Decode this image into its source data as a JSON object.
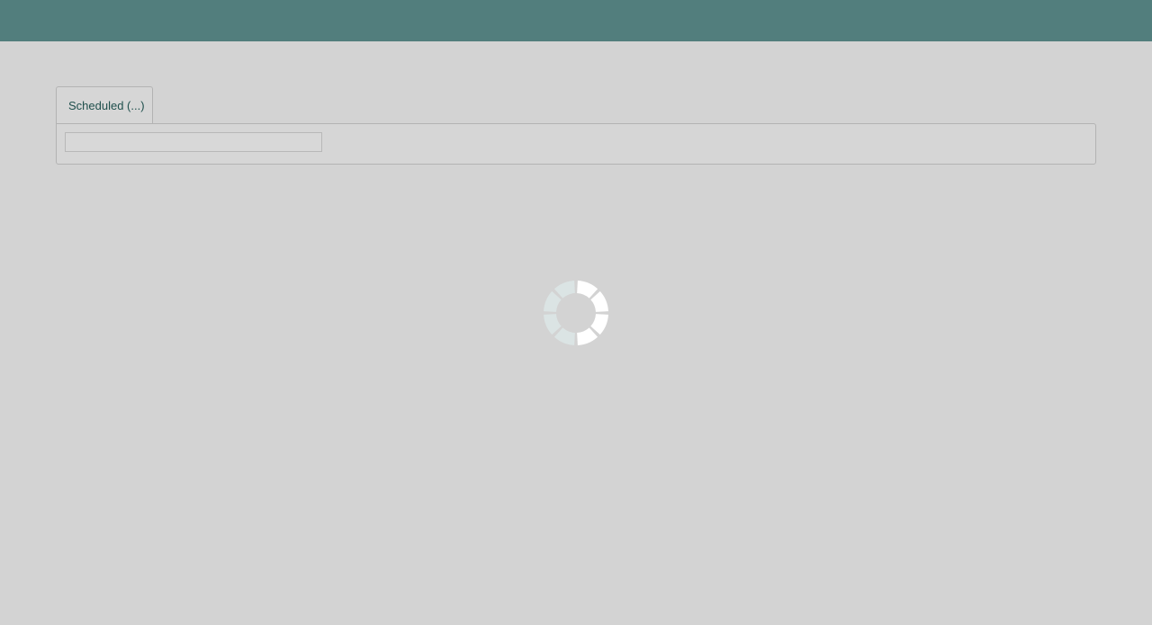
{
  "header": {
    "background": "#527e7d"
  },
  "tabs": [
    {
      "label": "Scheduled (...)"
    }
  ],
  "loading": {
    "icon": "spinner-icon",
    "colors": [
      "#ffffff",
      "#dbe4e4"
    ]
  }
}
